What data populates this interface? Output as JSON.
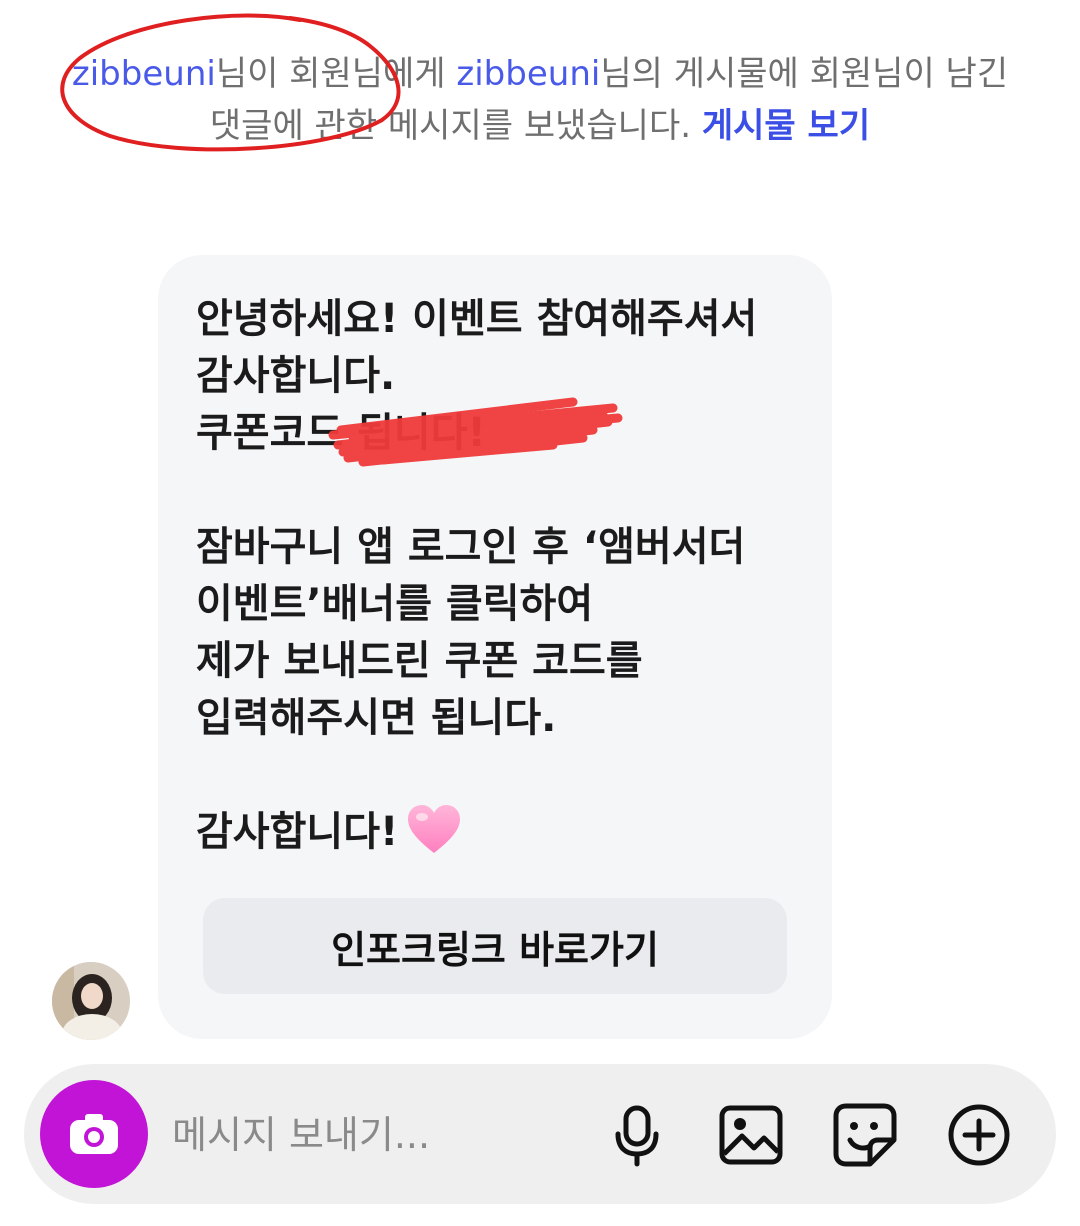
{
  "system_notice": {
    "username_1": "zibbeuni",
    "text_1": "님이 회원님에게 ",
    "username_2": "zibbeuni",
    "text_2": "님의 게시물에 회원님이 남긴 댓글에 관한 메시지를 보냈습니다. ",
    "link_label": "게시물 보기"
  },
  "message": {
    "body": "안녕하세요! 이벤트 참여해주셔서\n감사합니다.\n쿠폰코드                           됩니다!\n\n잠바구니 앱 로그인 후 ‘앰버서더\n이벤트’배너를 클릭하여\n제가 보내드린 쿠폰 코드를\n입력해주시면 됩니다.\n\n감사합니다!",
    "link_button_label": "인포크링크 바로가기"
  },
  "composer": {
    "placeholder": "메시지 보내기..."
  },
  "icons": [
    "camera-icon",
    "microphone-icon",
    "gallery-icon",
    "sticker-icon",
    "add-icon",
    "heart-emoji"
  ],
  "colors": {
    "username": "#4a5ae8",
    "link": "#3b4ee6",
    "camera_button": "#c214d7",
    "annotation_red": "#e02020"
  }
}
